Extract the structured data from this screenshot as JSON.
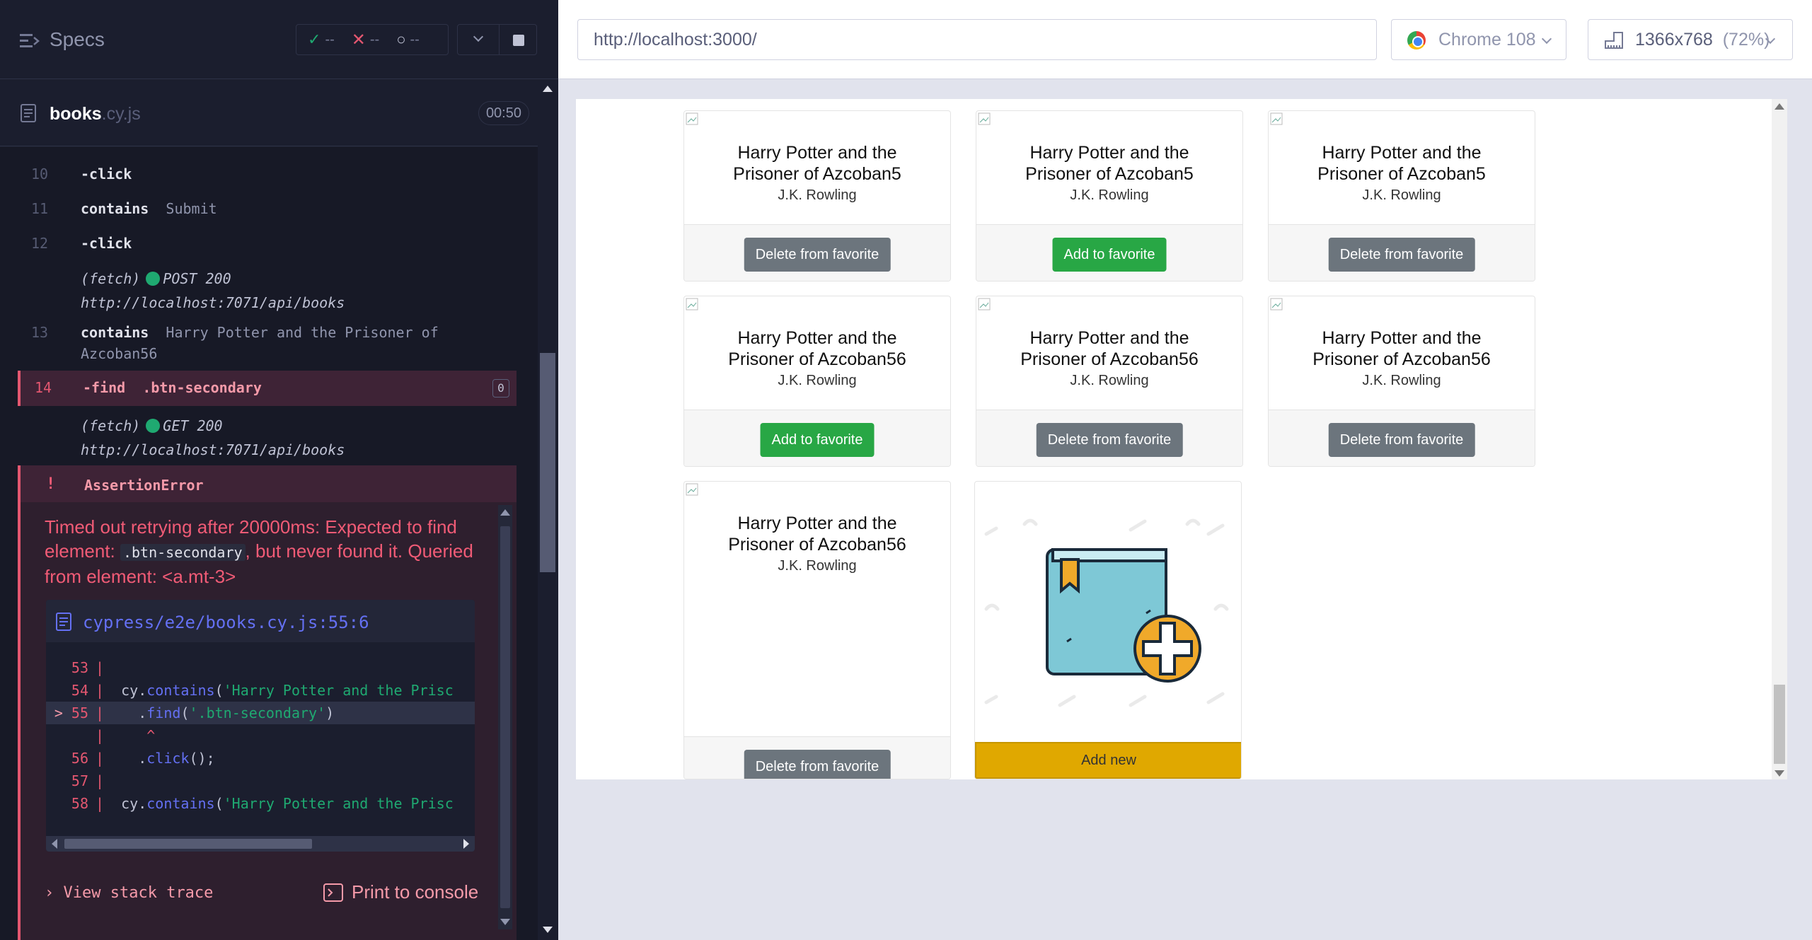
{
  "runner": {
    "specs_title": "Specs",
    "stats": {
      "passed": "--",
      "failed": "--",
      "pending": "--"
    },
    "spec_file": {
      "name": "books",
      "ext": ".cy.js",
      "duration": "00:50"
    },
    "commands": [
      {
        "num": "10",
        "name": "-click",
        "arg": ""
      },
      {
        "num": "11",
        "name": "contains",
        "arg": "Submit"
      },
      {
        "num": "12",
        "name": "-click",
        "arg": ""
      },
      {
        "num": "",
        "name": "(fetch)",
        "method": "POST 200",
        "url": "http://localhost:7071/api/books"
      },
      {
        "num": "13",
        "name": "contains",
        "arg": "Harry Potter and the Prisoner of",
        "arg2": "Azcoban56"
      },
      {
        "num": "14",
        "name": "-find",
        "arg": ".btn-secondary",
        "badge": "0"
      },
      {
        "num": "",
        "name": "(fetch)",
        "method": "GET 200",
        "url": "http://localhost:7071/api/books"
      }
    ],
    "error": {
      "marker": "!",
      "title": "AssertionError",
      "msg_part1": "Timed out retrying after 20000ms: Expected to find element:",
      "msg_code": ".btn-secondary",
      "msg_part2": ", but never found it. Queried from element: <a.mt-3>",
      "file_path": "cypress/e2e/books.cy.js:55:6",
      "code_lines": [
        {
          "ln": "53",
          "code": ""
        },
        {
          "ln": "54",
          "code": "  cy.contains('Harry Potter and the Prisc"
        },
        {
          "ln": "55",
          "code": "    .find('.btn-secondary')",
          "marker": ">"
        },
        {
          "ln": "",
          "code": "     ^"
        },
        {
          "ln": "56",
          "code": "    .click();"
        },
        {
          "ln": "57",
          "code": ""
        },
        {
          "ln": "58",
          "code": "  cy.contains('Harry Potter and the Prisc"
        }
      ],
      "view_stack_trace": "View stack trace",
      "print_to_console": "Print to console"
    }
  },
  "aut": {
    "url": "http://localhost:3000/",
    "browser": "Chrome 108",
    "viewport": "1366x768",
    "scale": "(72%)",
    "cards": [
      {
        "title1": "Harry Potter and the",
        "title2": "Prisoner of Azcoban5",
        "author": "J.K. Rowling",
        "button": "Delete from favorite",
        "kind": "secondary"
      },
      {
        "title1": "Harry Potter and the",
        "title2": "Prisoner of Azcoban5",
        "author": "J.K. Rowling",
        "button": "Add to favorite",
        "kind": "success"
      },
      {
        "title1": "Harry Potter and the",
        "title2": "Prisoner of Azcoban5",
        "author": "J.K. Rowling",
        "button": "Delete from favorite",
        "kind": "secondary"
      },
      {
        "title1": "Harry Potter and the",
        "title2": "Prisoner of Azcoban56",
        "author": "J.K. Rowling",
        "button": "Add to favorite",
        "kind": "success"
      },
      {
        "title1": "Harry Potter and the",
        "title2": "Prisoner of Azcoban56",
        "author": "J.K. Rowling",
        "button": "Delete from favorite",
        "kind": "secondary"
      },
      {
        "title1": "Harry Potter and the",
        "title2": "Prisoner of Azcoban56",
        "author": "J.K. Rowling",
        "button": "Delete from favorite",
        "kind": "secondary"
      },
      {
        "title1": "Harry Potter and the",
        "title2": "Prisoner of Azcoban56",
        "author": "J.K. Rowling",
        "button": "Delete from favorite",
        "kind": "secondary"
      }
    ],
    "add_new": "Add new"
  },
  "colors": {
    "accent_fail": "#e45770",
    "accent_pass": "#1fa971",
    "btn_secondary": "#6c757d",
    "btn_success": "#28a745",
    "btn_warning": "#e0a800"
  }
}
